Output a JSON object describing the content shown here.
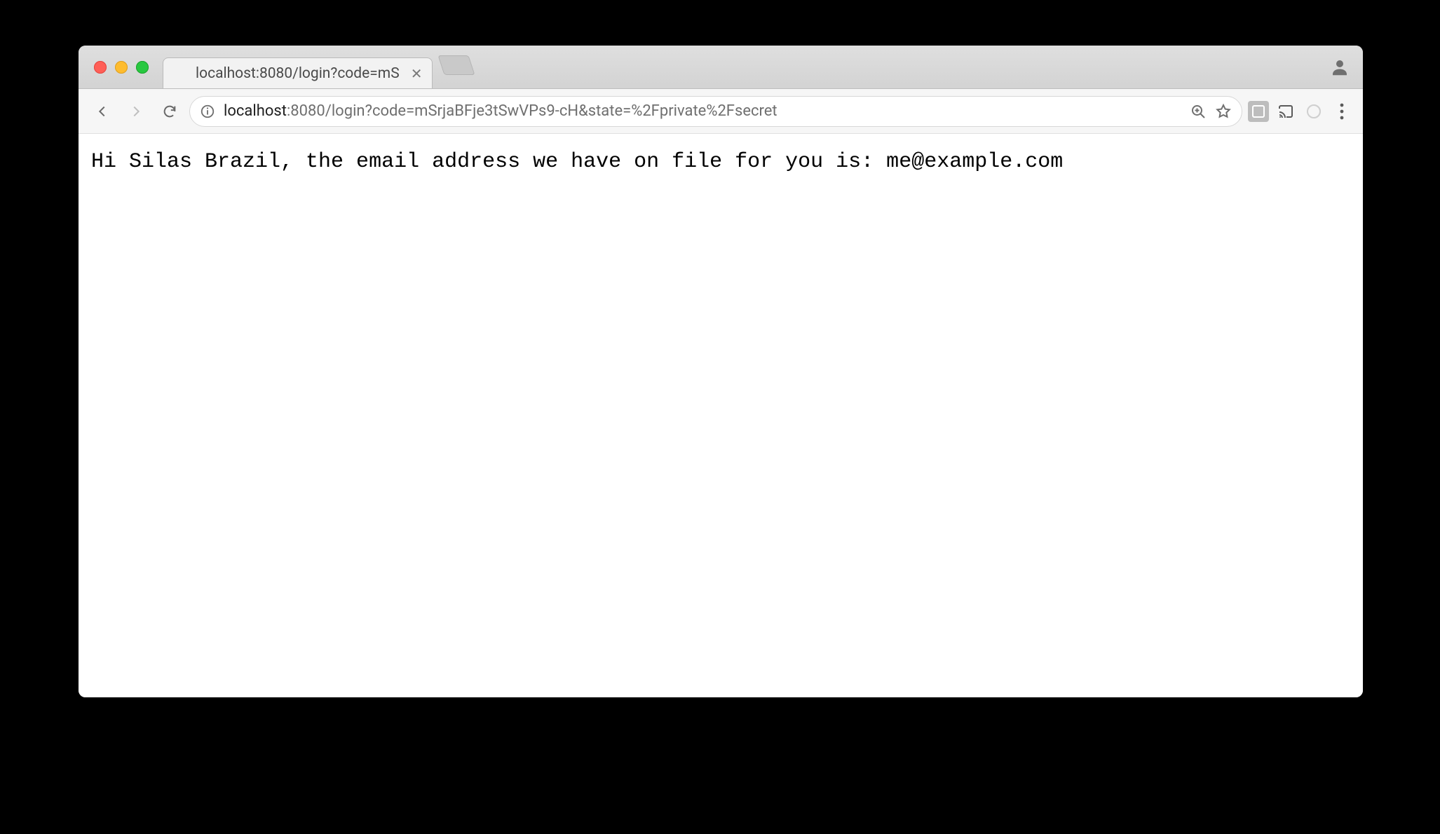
{
  "browser": {
    "tab": {
      "title": "localhost:8080/login?code=mS",
      "favicon": "leaf-icon"
    },
    "address": {
      "host": "localhost",
      "rest": ":8080/login?code=mSrjaBFje3tSwVPs9-cH&state=%2Fprivate%2Fsecret"
    }
  },
  "page": {
    "text": "Hi Silas Brazil, the email address we have on file for you is: me@example.com"
  }
}
